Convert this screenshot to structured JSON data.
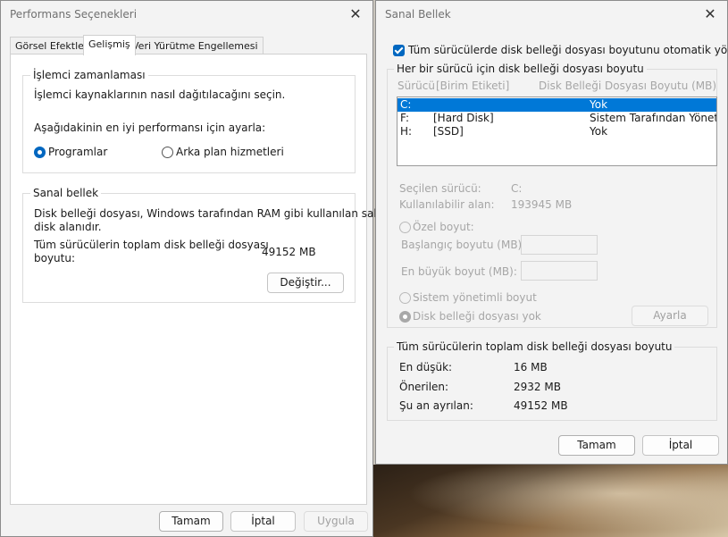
{
  "perf": {
    "title": "Performans Seçenekleri",
    "tabs": [
      {
        "label": "Görsel Efektler",
        "active": false
      },
      {
        "label": "Gelişmiş",
        "active": true
      },
      {
        "label": "Veri Yürütme Engellemesi",
        "active": false
      }
    ],
    "processor": {
      "title": "İşlemci zamanlaması",
      "desc": "İşlemci kaynaklarının nasıl dağıtılacağını seçin.",
      "prompt": "Aşağıdakinin en iyi performansı için ayarla:",
      "options": [
        {
          "label": "Programlar",
          "selected": true
        },
        {
          "label": "Arka plan hizmetleri",
          "selected": false
        }
      ]
    },
    "virtual_memory": {
      "title": "Sanal bellek",
      "desc_line1": "Disk belleği dosyası, Windows tarafından RAM gibi kullanılan sabit",
      "desc_line2": "disk alanıdır.",
      "total_label_line1": "Tüm sürücülerin toplam disk belleği dosyası",
      "total_label_line2": "boyutu:",
      "total_value": "49152 MB",
      "change_button": "Değiştir..."
    },
    "buttons": {
      "ok": "Tamam",
      "cancel": "İptal",
      "apply": "Uygula"
    }
  },
  "vm": {
    "title": "Sanal Bellek",
    "auto_manage_label": "Tüm sürücülerde disk belleği dosyası boyutunu otomatik yönet",
    "auto_manage_checked": true,
    "per_drive_title": "Her bir sürücü için disk belleği dosyası boyutu",
    "columns": {
      "drive": "Sürücü",
      "label": "[Birim Etiketi]",
      "size": "Disk Belleği Dosyası Boyutu (MB)"
    },
    "drives": [
      {
        "drive": "C:",
        "label": "",
        "size": "Yok",
        "selected": true
      },
      {
        "drive": "F:",
        "label": "[Hard Disk]",
        "size": "Sistem Tarafından Yönetilen",
        "selected": false
      },
      {
        "drive": "H:",
        "label": "[SSD]",
        "size": "Yok",
        "selected": false
      }
    ],
    "selected_drive_label": "Seçilen sürücü:",
    "selected_drive_value": "C:",
    "available_label": "Kullanılabilir alan:",
    "available_value": "193945 MB",
    "custom_size_label": "Özel boyut:",
    "initial_size_label": "Başlangıç boyutu (MB):",
    "initial_size_value": "",
    "max_size_label": "En büyük boyut (MB):",
    "max_size_value": "",
    "system_managed_label": "Sistem yönetimli boyut",
    "no_paging_label": "Disk belleği dosyası yok",
    "selected_option": "no_paging",
    "set_button": "Ayarla",
    "totals": {
      "title": "Tüm sürücülerin toplam disk belleği dosyası boyutu",
      "min_label": "En düşük:",
      "min_value": "16 MB",
      "recommended_label": "Önerilen:",
      "recommended_value": "2932 MB",
      "allocated_label": "Şu an ayrılan:",
      "allocated_value": "49152 MB"
    },
    "buttons": {
      "ok": "Tamam",
      "cancel": "İptal"
    }
  },
  "colors": {
    "accent": "#0067c0",
    "selection": "#0078d7"
  }
}
